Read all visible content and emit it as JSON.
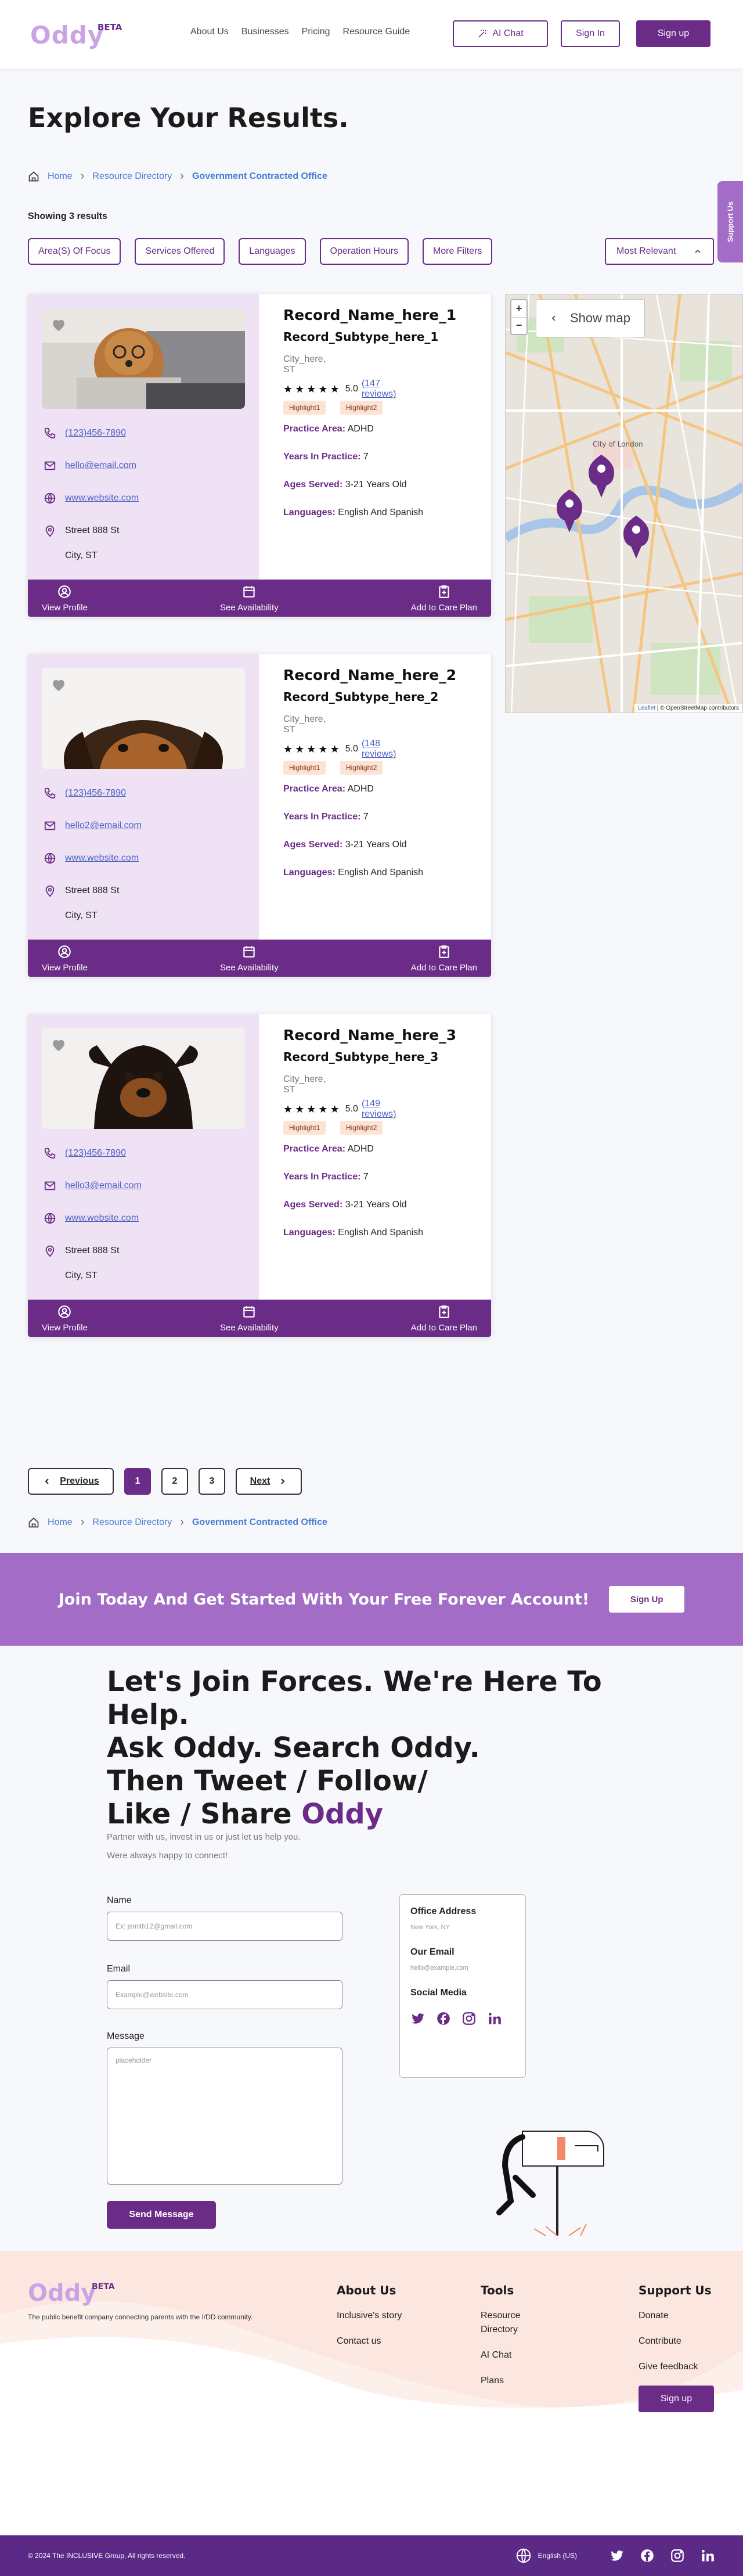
{
  "nav": {
    "logo": "Oddy",
    "beta": "BETA",
    "links": [
      "About Us",
      "Businesses",
      "Pricing",
      "Resource Guide"
    ],
    "ai_chat": "AI Chat",
    "sign_in": "Sign In",
    "sign_up": "Sign up"
  },
  "page_title": "Explore Your Results.",
  "breadcrumb": {
    "home": "Home",
    "directory": "Resource Directory",
    "current": "Government Contracted Office"
  },
  "showing": "Showing 3 results",
  "filters": [
    "Area(S) Of Focus",
    "Services Offered",
    "Languages",
    "Operation Hours",
    "More Filters"
  ],
  "sort": "Most Relevant",
  "support_tab": "Support Us",
  "cards": [
    {
      "name": "Record_Name_here_1",
      "subtype": "Record_Subtype_here_1",
      "city": "City_here, ST",
      "rating": "5.0",
      "reviews": "(147 reviews)",
      "highlights": [
        "Highlight1",
        "Highlight2"
      ],
      "phone": "(123)456-7890",
      "email": "hello@email.com",
      "website": "www.website.com",
      "street": "Street 888 St",
      "citystate": "City, ST",
      "practice_label": "Practice Area:",
      "practice": "ADHD",
      "years_label": "Years In Practice:",
      "years": "7",
      "ages_label": "Ages Served:",
      "ages": "3-21 Years Old",
      "lang_label": "Languages:",
      "languages": "English And Spanish"
    },
    {
      "name": "Record_Name_here_2",
      "subtype": "Record_Subtype_here_2",
      "city": "City_here, ST",
      "rating": "5.0",
      "reviews": "(148 reviews)",
      "highlights": [
        "Highlight1",
        "Highlight2"
      ],
      "phone": "(123)456-7890",
      "email": "hello2@email.com",
      "website": "www.website.com",
      "street": "Street 888 St",
      "citystate": "City, ST",
      "practice_label": "Practice Area:",
      "practice": "ADHD",
      "years_label": "Years In Practice:",
      "years": "7",
      "ages_label": "Ages Served:",
      "ages": "3-21 Years Old",
      "lang_label": "Languages:",
      "languages": "English And Spanish"
    },
    {
      "name": "Record_Name_here_3",
      "subtype": "Record_Subtype_here_3",
      "city": "City_here, ST",
      "rating": "5.0",
      "reviews": "(149 reviews)",
      "highlights": [
        "Highlight1",
        "Highlight2"
      ],
      "phone": "(123)456-7890",
      "email": "hello3@email.com",
      "website": "www.website.com",
      "street": "Street 888 St",
      "citystate": "City, ST",
      "practice_label": "Practice Area:",
      "practice": "ADHD",
      "years_label": "Years In Practice:",
      "years": "7",
      "ages_label": "Ages Served:",
      "ages": "3-21 Years Old",
      "lang_label": "Languages:",
      "languages": "English And Spanish"
    }
  ],
  "card_actions": {
    "view_profile": "View Profile",
    "see_availability": "See Availability",
    "add_care": "Add to Care Plan"
  },
  "map": {
    "show_map": "Show map",
    "zoom_in": "+",
    "zoom_out": "−",
    "attr_leaflet": "Leaflet",
    "attr_osm": "© OpenStreetMap contributors",
    "label_city": "City of London"
  },
  "pagination": {
    "prev": "Previous",
    "pages": [
      "1",
      "2",
      "3"
    ],
    "next": "Next"
  },
  "cta": {
    "text": "Join Today And Get Started With Your Free Forever Account!",
    "button": "Sign Up"
  },
  "join": {
    "line1": "Let's Join Forces. We're Here To Help.",
    "line2": "Ask Oddy. Search Oddy.",
    "line3": "Then Tweet / Follow/",
    "line4a": "Like / Share ",
    "line4b": "Oddy",
    "p1": "Partner with us, invest in us or just let us help you.",
    "p2": "Were always happy to connect!"
  },
  "form": {
    "name_label": "Name",
    "name_ph": "Ex: jsmith12@gmail.com",
    "email_label": "Email",
    "email_ph": "Example@website.com",
    "msg_label": "Message",
    "msg_ph": "placeholder",
    "send": "Send Message"
  },
  "info": {
    "office_h": "Office Address",
    "office_v": "New York, NY",
    "email_h": "Our Email",
    "email_v": "hello@example.com",
    "social_h": "Social Media"
  },
  "footer": {
    "logo": "Oddy",
    "beta": "BETA",
    "tagline": "The public benefit company connecting parents with the I/DD community.",
    "about_h": "About Us",
    "about_links": [
      "Inclusive's story",
      "Contact us"
    ],
    "tools_h": "Tools",
    "tools_links": [
      "Resource Directory",
      "AI Chat",
      "Plans"
    ],
    "support_h": "Support Us",
    "support_links": [
      "Donate",
      "Contribute",
      "Give feedback"
    ],
    "sign_up": "Sign up",
    "copyright": "© 2024 The INCLUSIVE Group, All rights reserved.",
    "language": "English (US)"
  },
  "colors": {
    "brand": "#6a2c86",
    "brand_light": "#a36cc6",
    "logo": "#c9a3e6",
    "card_left": "#efe2f4",
    "highlight": "#fbe3d6"
  }
}
